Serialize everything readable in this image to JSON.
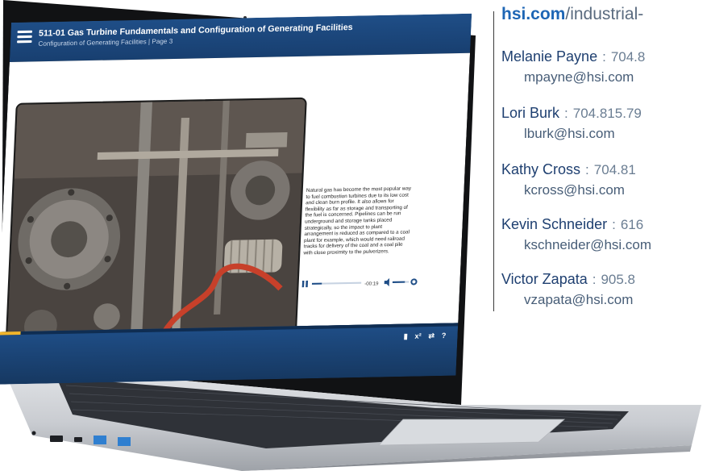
{
  "course": {
    "title": "511-01 Gas Turbine Fundamentals and Configuration of Generating Facilities",
    "subtitle": "Configuration of Generating Facilities | Page 3"
  },
  "narration": "Natural gas has become the most popular way to fuel combustion turbines due to its low cost and clean burn profile. It also allows for flexibility as far as storage and transporting of the fuel is concerned. Pipelines can be run underground and storage tanks placed strategically, so the impact to plant arrangement is reduced as compared to a coal plant for example, which would need railroad tracks for delivery of the coal and a coal pile with close proximity to the pulverizers.",
  "player": {
    "pause_icon": "pause-icon",
    "time": "-00:19",
    "progress": 0.2,
    "volume_icon": "volume-icon",
    "volume": 0.75,
    "settings_icon": "gear-icon"
  },
  "nav": {
    "back_icon": "left-arrow-icon",
    "forward_icon": "right-arrow-icon"
  },
  "toolbar": {
    "glossary_icon": "book-icon",
    "calculator_icon": "x-squared-icon",
    "swap_icon": "swap-arrows-icon",
    "help_icon": "question-icon"
  },
  "course_progress": 0.05,
  "website": {
    "domain": "hsi.com",
    "path": "/industrial-"
  },
  "contacts": [
    {
      "name": "Melanie Payne",
      "phone": "704.8",
      "email": "mpayne@hsi.com"
    },
    {
      "name": "Lori Burk",
      "phone": "704.815.79",
      "email": "lburk@hsi.com"
    },
    {
      "name": "Kathy Cross",
      "phone": "704.81",
      "email": "kcross@hsi.com"
    },
    {
      "name": "Kevin Schneider",
      "phone": "616",
      "email": "kschneider@hsi.com"
    },
    {
      "name": "Victor Zapata",
      "phone": "905.8",
      "email": "vzapata@hsi.com"
    }
  ],
  "colors": {
    "brand_blue": "#1e66b5",
    "name_blue": "#1e3f70",
    "header_blue": "#1f4e87",
    "accent_yellow": "#f0b42a"
  }
}
